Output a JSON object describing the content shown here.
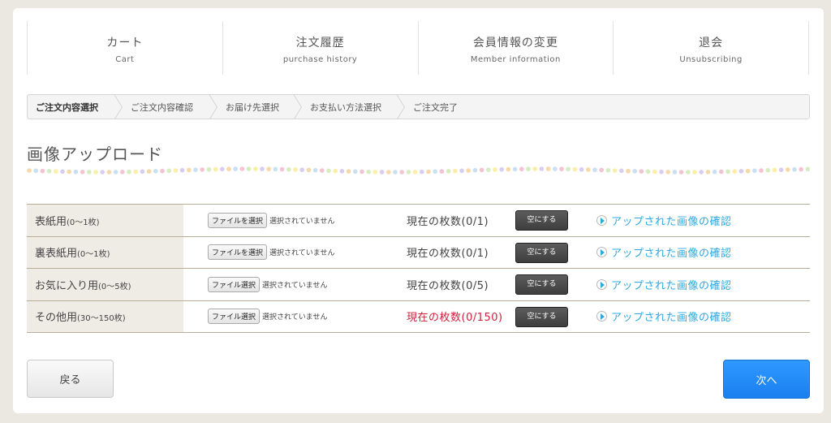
{
  "nav": [
    {
      "jp": "カート",
      "en": "Cart"
    },
    {
      "jp": "注文履歴",
      "en": "purchase history"
    },
    {
      "jp": "会員情報の変更",
      "en": "Member information"
    },
    {
      "jp": "退会",
      "en": "Unsubscribing"
    }
  ],
  "steps": [
    "ご注文内容選択",
    "ご注文内容確認",
    "お届け先選択",
    "お支払い方法選択",
    "ご注文完了"
  ],
  "page_title": "画像アップロード",
  "rows": [
    {
      "label": "表紙用",
      "range": "(0〜1枚)",
      "file_button": "ファイルを選択",
      "file_status": "選択されていません",
      "count": "現在の枚数(0/1)",
      "clear": "空にする",
      "confirm": "アップされた画像の確認"
    },
    {
      "label": "裏表紙用",
      "range": "(0〜1枚)",
      "file_button": "ファイルを選択",
      "file_status": "選択されていません",
      "count": "現在の枚数(0/1)",
      "clear": "空にする",
      "confirm": "アップされた画像の確認"
    },
    {
      "label": "お気に入り用",
      "range": "(0〜5枚)",
      "file_button": "ファイル選択",
      "file_status": "選択されていません",
      "count": "現在の枚数(0/5)",
      "clear": "空にする",
      "confirm": "アップされた画像の確認"
    },
    {
      "label": "その他用",
      "range": "(30〜150枚)",
      "file_button": "ファイル選択",
      "file_status": "選択されていません",
      "count": "現在の枚数(0/150)",
      "clear": "空にする",
      "confirm": "アップされた画像の確認"
    }
  ],
  "buttons": {
    "back": "戻る",
    "next": "次へ"
  },
  "colors": {
    "accent": "#2ea8e0",
    "warning": "#d0213b",
    "primary_button": "#1f88f5"
  }
}
